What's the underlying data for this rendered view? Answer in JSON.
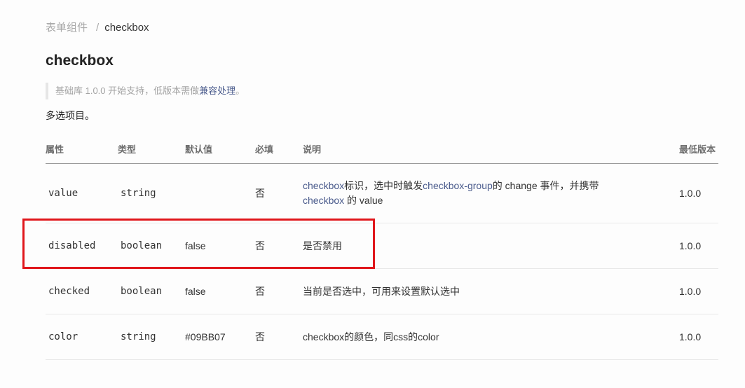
{
  "breadcrumb": {
    "parent": "表单组件",
    "separator": "/",
    "current": "checkbox"
  },
  "page_title": "checkbox",
  "notice": {
    "prefix": "基础库 1.0.0 开始支持，低版本需做",
    "link": "兼容处理",
    "suffix": "。"
  },
  "description": "多选项目。",
  "table": {
    "headers": {
      "attr": "属性",
      "type": "类型",
      "default": "默认值",
      "required": "必填",
      "desc": "说明",
      "version": "最低版本"
    },
    "rows": [
      {
        "attr": "value",
        "type": "string",
        "default": "",
        "required": "否",
        "desc_parts": {
          "link1": "checkbox",
          "text1": "标识，选中时触发",
          "link2": "checkbox-group",
          "text2": "的 change 事件，并携带",
          "link3": "checkbox",
          "text3": " 的 value"
        },
        "version": "1.0.0"
      },
      {
        "attr": "disabled",
        "type": "boolean",
        "default": "false",
        "required": "否",
        "desc": "是否禁用",
        "version": "1.0.0"
      },
      {
        "attr": "checked",
        "type": "boolean",
        "default": "false",
        "required": "否",
        "desc": "当前是否选中，可用来设置默认选中",
        "version": "1.0.0"
      },
      {
        "attr": "color",
        "type": "string",
        "default": "#09BB07",
        "required": "否",
        "desc": "checkbox的颜色，同css的color",
        "version": "1.0.0"
      }
    ]
  },
  "colors": {
    "highlight_border": "#e0161b",
    "link": "#4a5b8c",
    "version_text": "#7a86a6"
  }
}
